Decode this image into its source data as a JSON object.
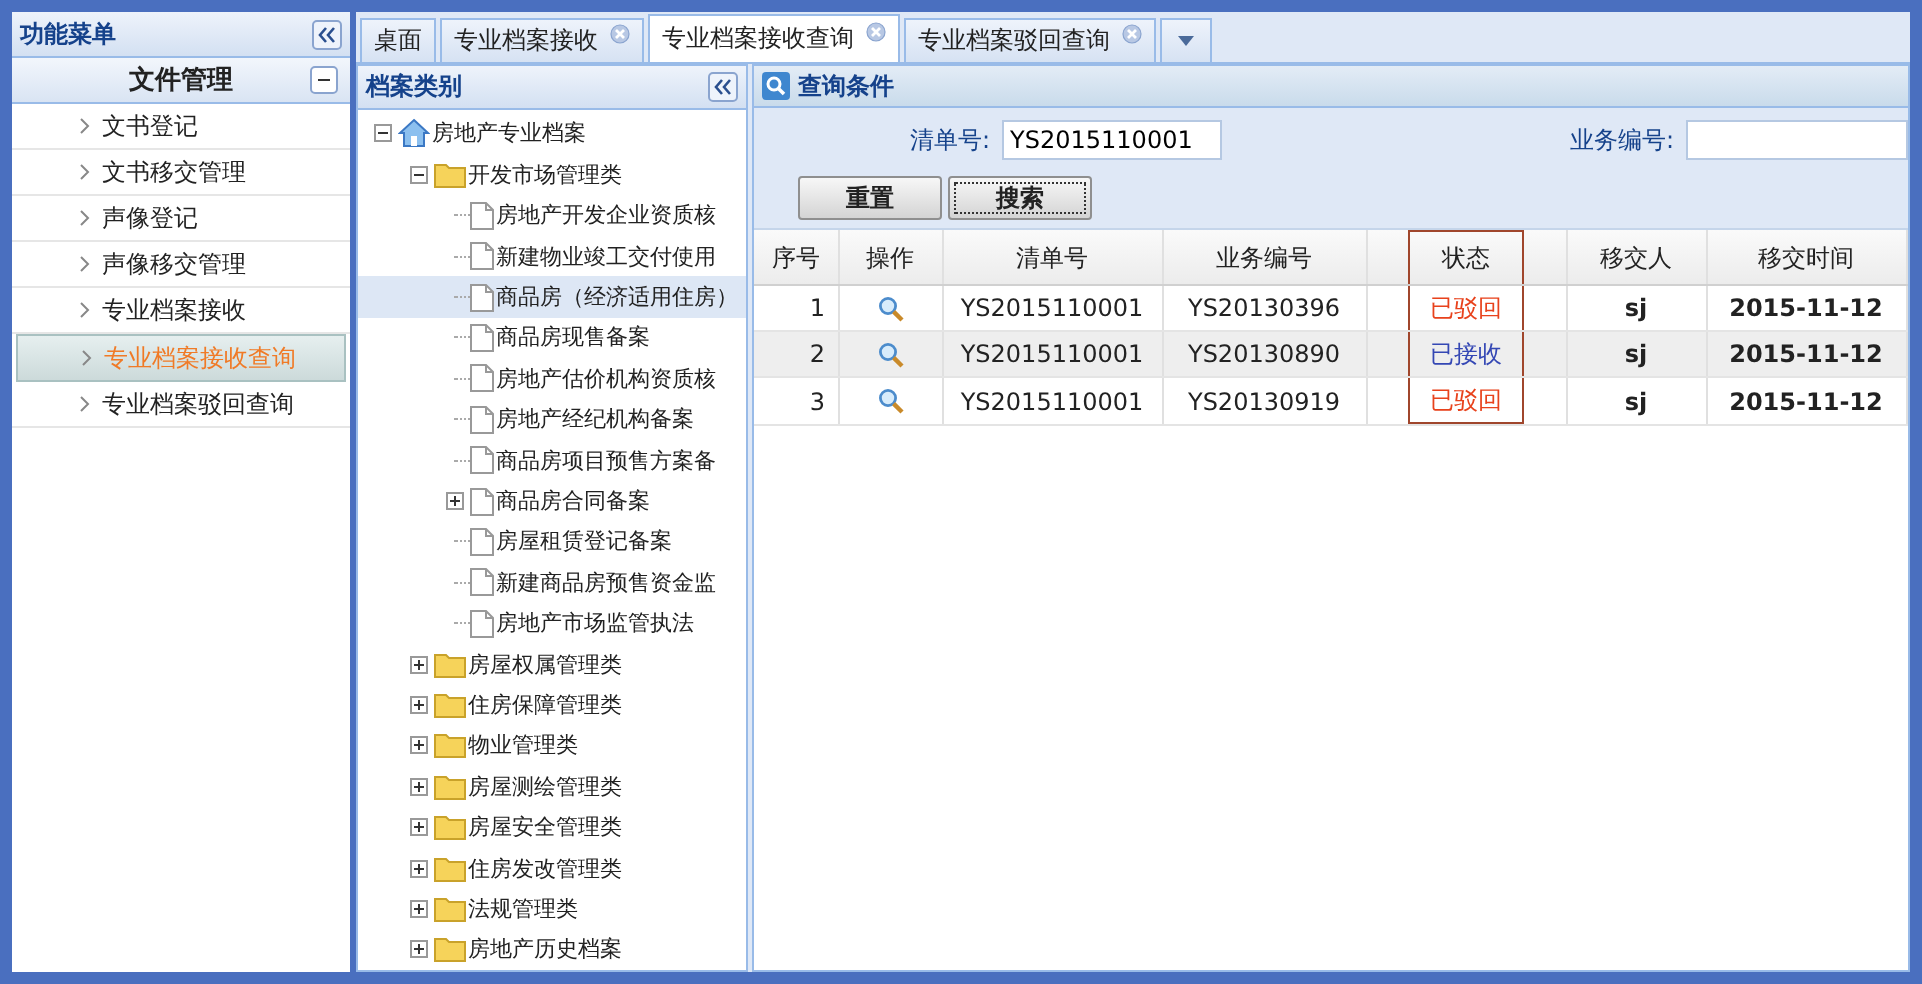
{
  "menu": {
    "title": "功能菜单",
    "section": {
      "label": "文件管理",
      "expanded": true
    },
    "items": [
      {
        "label": "文书登记",
        "selected": false
      },
      {
        "label": "文书移交管理",
        "selected": false
      },
      {
        "label": "声像登记",
        "selected": false
      },
      {
        "label": "声像移交管理",
        "selected": false
      },
      {
        "label": "专业档案接收",
        "selected": false
      },
      {
        "label": "专业档案接收查询",
        "selected": true
      },
      {
        "label": "专业档案驳回查询",
        "selected": false
      }
    ]
  },
  "tabs": [
    {
      "label": "桌面",
      "closable": false,
      "selected": false
    },
    {
      "label": "专业档案接收",
      "closable": true,
      "selected": false
    },
    {
      "label": "专业档案接收查询",
      "closable": true,
      "selected": true
    },
    {
      "label": "专业档案驳回查询",
      "closable": true,
      "selected": false
    }
  ],
  "tree": {
    "title": "档案类别",
    "nodes": [
      {
        "label": "房地产专业档案",
        "kind": "home",
        "expanded": true,
        "selected": false,
        "children": [
          {
            "label": "开发市场管理类",
            "kind": "folder",
            "expanded": true,
            "selected": false,
            "children": [
              {
                "label": "房地产开发企业资质核",
                "kind": "file",
                "selected": false
              },
              {
                "label": "新建物业竣工交付使用",
                "kind": "file",
                "selected": false
              },
              {
                "label": "商品房（经济适用住房）",
                "kind": "file",
                "selected": true
              },
              {
                "label": "商品房现售备案",
                "kind": "file",
                "selected": false
              },
              {
                "label": "房地产估价机构资质核",
                "kind": "file",
                "selected": false
              },
              {
                "label": "房地产经纪机构备案",
                "kind": "file",
                "selected": false
              },
              {
                "label": "商品房项目预售方案备",
                "kind": "file",
                "selected": false
              },
              {
                "label": "商品房合同备案",
                "kind": "file",
                "expanded": false,
                "selected": false
              },
              {
                "label": "房屋租赁登记备案",
                "kind": "file",
                "selected": false
              },
              {
                "label": "新建商品房预售资金监",
                "kind": "file",
                "selected": false
              },
              {
                "label": "房地产市场监管执法",
                "kind": "file",
                "selected": false
              }
            ]
          },
          {
            "label": "房屋权属管理类",
            "kind": "folder",
            "expanded": false,
            "selected": false
          },
          {
            "label": "住房保障管理类",
            "kind": "folder",
            "expanded": false,
            "selected": false
          },
          {
            "label": "物业管理类",
            "kind": "folder",
            "expanded": false,
            "selected": false
          },
          {
            "label": "房屋测绘管理类",
            "kind": "folder",
            "expanded": false,
            "selected": false
          },
          {
            "label": "房屋安全管理类",
            "kind": "folder",
            "expanded": false,
            "selected": false
          },
          {
            "label": "住房发改管理类",
            "kind": "folder",
            "expanded": false,
            "selected": false
          },
          {
            "label": "法规管理类",
            "kind": "folder",
            "expanded": false,
            "selected": false
          },
          {
            "label": "房地产历史档案",
            "kind": "folder",
            "expanded": false,
            "selected": false
          }
        ]
      }
    ]
  },
  "query": {
    "title": "查询条件",
    "fields": [
      {
        "label": "清单号:",
        "value": "YS2015110001"
      },
      {
        "label": "业务编号:"
      }
    ],
    "buttons": [
      {
        "label": "重置",
        "focused": false
      },
      {
        "label": "搜索",
        "focused": true
      }
    ]
  },
  "table": {
    "columns": [
      {
        "label": "序号",
        "highlighted": false
      },
      {
        "label": "操作",
        "highlighted": false
      },
      {
        "label": "清单号",
        "highlighted": false
      },
      {
        "label": "业务编号",
        "highlighted": false
      },
      {
        "label": "状态",
        "highlighted": true
      },
      {
        "label": "移交人",
        "highlighted": false
      },
      {
        "label": "移交时间",
        "highlighted": false
      }
    ],
    "rows": [
      {
        "no": "1",
        "list_no": "YS2015110001",
        "business_no": "YS20130396",
        "status": "已驳回",
        "color": "#e8421c",
        "person": "sj",
        "time": "2015-11-12"
      },
      {
        "no": "2",
        "list_no": "YS2015110001",
        "business_no": "YS20130890",
        "status": "已接收",
        "color": "#3447b4",
        "person": "sj",
        "time": "2015-11-12"
      },
      {
        "no": "3",
        "list_no": "YS2015110001",
        "business_no": "YS20130919",
        "status": "已驳回",
        "color": "#e8421c",
        "person": "sj",
        "time": "2015-11-12"
      }
    ]
  }
}
